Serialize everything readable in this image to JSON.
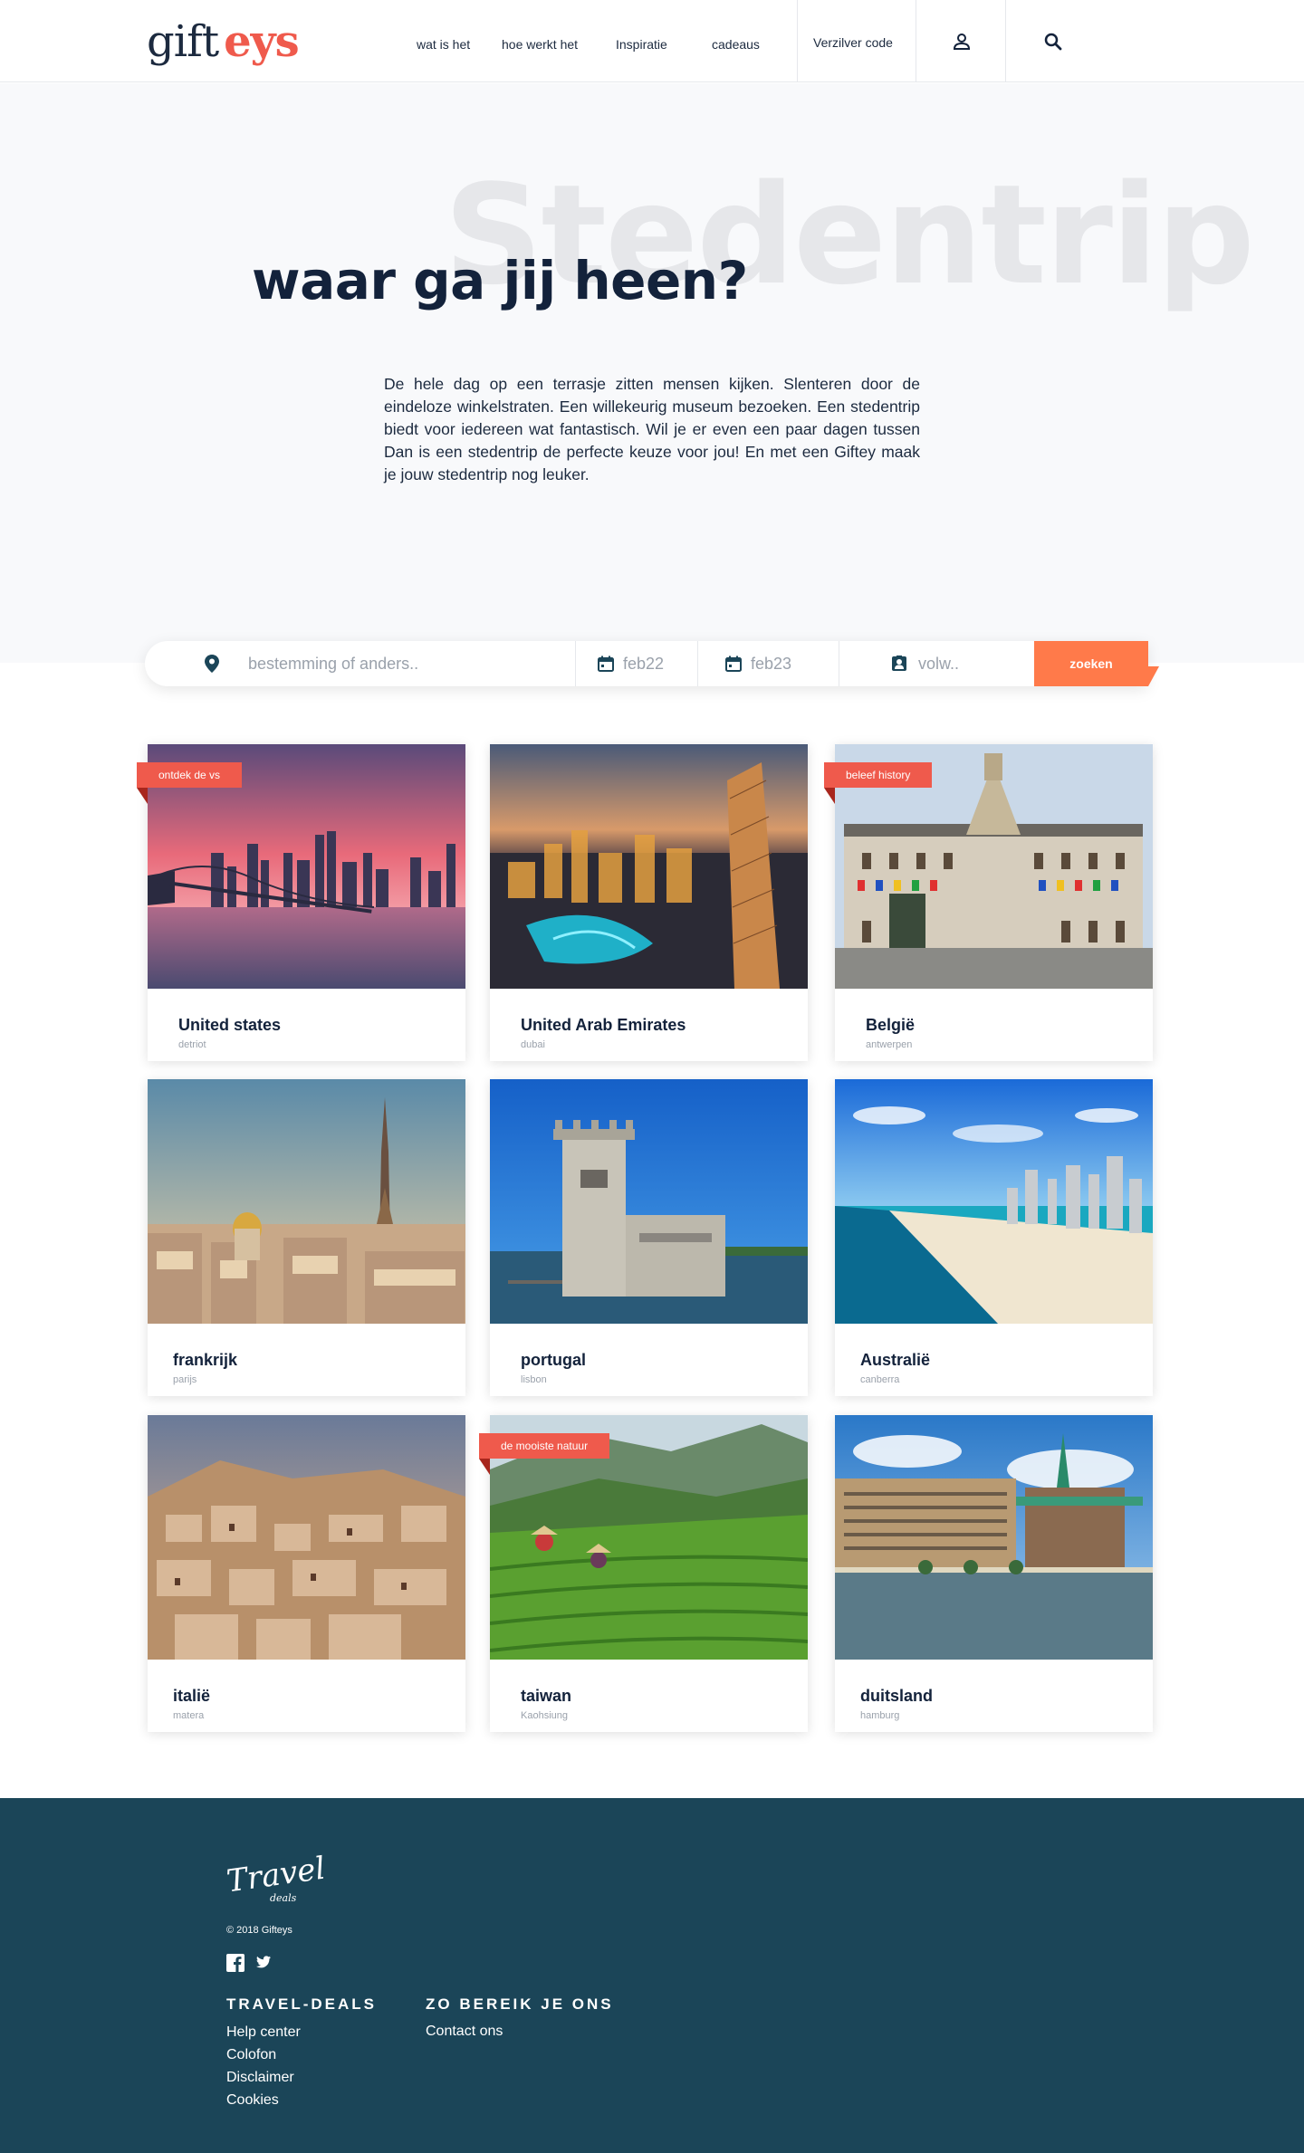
{
  "header": {
    "logo_part1": "gift",
    "logo_part2": "eys",
    "nav": [
      "wat is het",
      "hoe werkt het",
      "Inspiratie",
      "cadeaus"
    ],
    "voucher_label": "Verzilver code"
  },
  "hero": {
    "watermark": "Stedentrip",
    "title": "waar ga jij heen?",
    "text": "De hele dag op een terrasje zitten mensen kijken. Slenteren door de eindeloze winkelstraten. Een willekeurig museum bezoeken. Een stedentrip biedt voor iedereen wat fantastisch. Wil je er even een paar dagen tussen Dan is een stedentrip de perfecte keuze voor jou! En met een Giftey maak je jouw stedentrip nog leuker."
  },
  "search": {
    "destination_placeholder": "bestemming of anders..",
    "date_from": "feb22",
    "date_to": "feb23",
    "people_placeholder": "volw..",
    "button_label": "zoeken"
  },
  "cards": [
    {
      "title": "United states",
      "subtitle": "detriot",
      "tag": "ontdek de vs"
    },
    {
      "title": "United Arab Emirates",
      "subtitle": "dubai",
      "tag": ""
    },
    {
      "title": "België",
      "subtitle": "antwerpen",
      "tag": "beleef history"
    },
    {
      "title": "frankrijk",
      "subtitle": "parijs",
      "tag": ""
    },
    {
      "title": "portugal",
      "subtitle": "lisbon",
      "tag": ""
    },
    {
      "title": "Australië",
      "subtitle": "canberra",
      "tag": ""
    },
    {
      "title": "italië",
      "subtitle": "matera",
      "tag": ""
    },
    {
      "title": "taiwan",
      "subtitle": "Kaohsiung",
      "tag": "de mooiste natuur"
    },
    {
      "title": "duitsland",
      "subtitle": "hamburg",
      "tag": ""
    }
  ],
  "footer": {
    "logo_text": "Travel",
    "logo_sub": "deals",
    "copyright": "© 2018 Gifteys",
    "col1_heading": "TRAVEL-DEALS",
    "col1_links": [
      "Help center",
      "Colofon",
      "Disclaimer",
      "Cookies"
    ],
    "col2_heading": "ZO BEREIK JE ONS",
    "col2_links": [
      "Contact ons"
    ]
  },
  "colors": {
    "accent": "#ef5a4c",
    "search_button": "#ff7a4a",
    "navy": "#13223b",
    "footer_bg": "#1b4558"
  },
  "icons": [
    "user-icon",
    "search-icon",
    "location-pin-icon",
    "calendar-icon",
    "person-badge-icon",
    "facebook-icon",
    "twitter-icon"
  ]
}
